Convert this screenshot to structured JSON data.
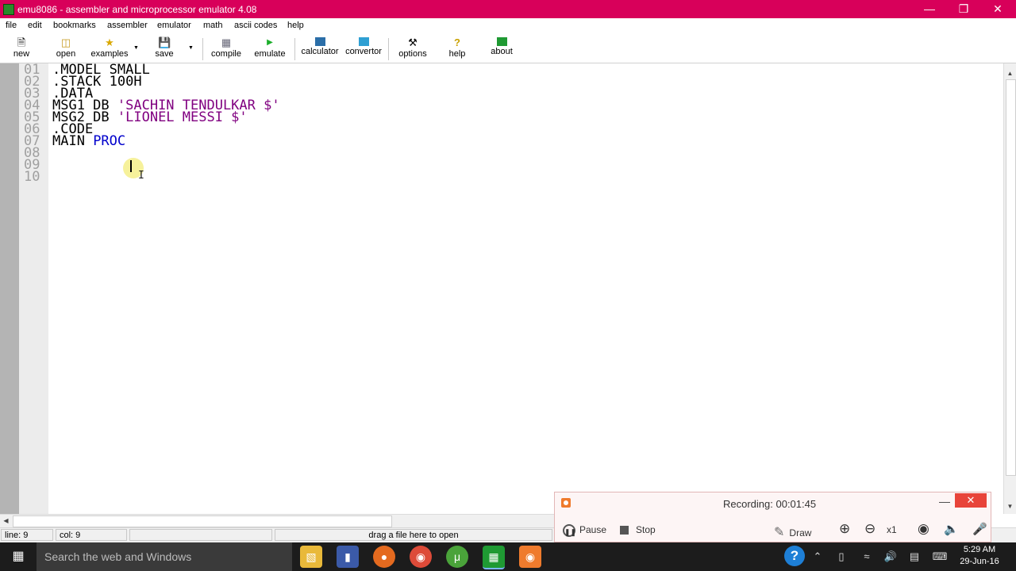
{
  "window": {
    "title": "emu8086 - assembler and microprocessor emulator 4.08",
    "minimize_icon": "minimize-icon",
    "restore_icon": "restore-icon",
    "close_icon": "close-icon"
  },
  "menu": [
    "file",
    "edit",
    "bookmarks",
    "assembler",
    "emulator",
    "math",
    "ascii codes",
    "help"
  ],
  "toolbar": {
    "new": "new",
    "open": "open",
    "examples": "examples",
    "save": "save",
    "compile": "compile",
    "emulate": "emulate",
    "calculator": "calculator",
    "convertor": "convertor",
    "options": "options",
    "help": "help",
    "about": "about"
  },
  "editor": {
    "line_numbers": [
      "01",
      "02",
      "03",
      "04",
      "05",
      "06",
      "07",
      "08",
      "09",
      "10"
    ],
    "lines": {
      "l1": ".MODEL SMALL",
      "l2": ".STACK 100H",
      "l3": ".DATA",
      "l4a": "MSG1 DB ",
      "l4b": "'SACHIN TENDULKAR $'",
      "l5a": "MSG2 DB ",
      "l5b": "'LIONEL MESSI $'",
      "l6": ".CODE",
      "l7a": "MAIN ",
      "l7b": "PROC"
    },
    "colors": {
      "keyword": "#0000cc",
      "string": "#800080",
      "line_number": "#a0a0a0"
    }
  },
  "status": {
    "line": "line: 9",
    "col": "col: 9",
    "hint": "drag a file here to open"
  },
  "recorder": {
    "status": "Recording:  00:01:45",
    "pause": "Pause",
    "stop": "Stop",
    "draw": "Draw",
    "zoom": "x1"
  },
  "taskbar": {
    "search_placeholder": "Search the web and Windows",
    "time": "5:29 AM",
    "date": "29-Jun-16"
  },
  "accent": {
    "titlebar": "#d8005a"
  }
}
